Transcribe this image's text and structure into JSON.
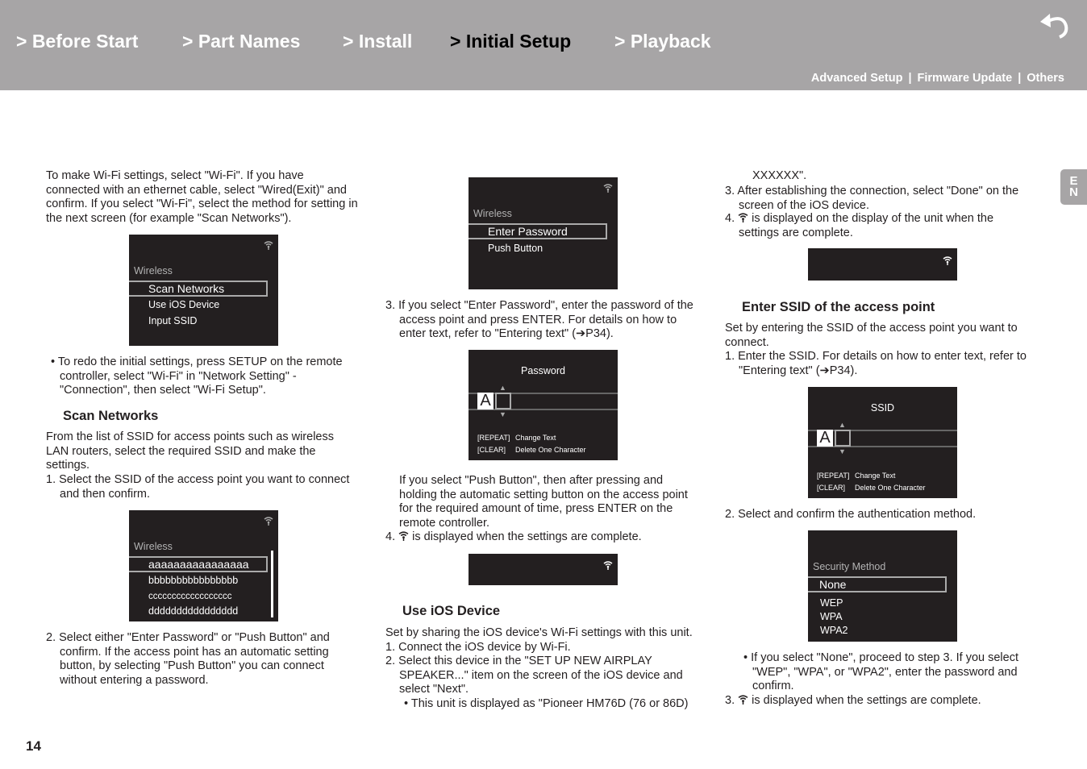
{
  "header": {
    "nav": [
      {
        "label": "> Before Start"
      },
      {
        "label": "> Part Names"
      },
      {
        "label": "> Install"
      },
      {
        "label": "> Initial Setup",
        "current": true
      },
      {
        "label": "> Playback"
      }
    ],
    "sub": [
      "Advanced Setup",
      "Firmware Update",
      "Others"
    ],
    "back_icon": "return-arrow-icon",
    "lang_tab": "EN"
  },
  "col1": {
    "p1": "To make Wi-Fi settings, select \"Wi-Fi\". If you have connected with an ethernet cable, select \"Wired(Exit)\" and confirm. If you select \"Wi-Fi\", select the method for setting in the next screen (for example \"Scan Networks\").",
    "screen1": {
      "title": "Wireless",
      "selected": "Scan Networks",
      "items": [
        "Use iOS Device",
        "Input SSID"
      ]
    },
    "b1": "• To redo the initial settings, press SETUP on the remote controller, select \"Wi-Fi\" in \"Network Setting\" - \"Connection\", then select \"Wi-Fi Setup\".",
    "h1": "Scan Networks",
    "p2": "From the list of SSID for access points such as wireless LAN routers, select the required SSID and make the settings.",
    "s1": "1. Select the SSID of the access point you want to connect and then confirm.",
    "screen2": {
      "title": "Wireless",
      "selected": "aaaaaaaaaaaaaaaa",
      "items": [
        "bbbbbbbbbbbbbbbb",
        "cccccccccccccccccc",
        "dddddddddddddddd"
      ]
    },
    "s2": "2. Select either \"Enter Password\" or \"Push Button\" and confirm. If the access point has an automatic setting button, by selecting \"Push Button\" you can connect without entering a password."
  },
  "col2": {
    "screen1": {
      "title": "Wireless",
      "selected": "Enter Password",
      "items": [
        "Push Button"
      ]
    },
    "s3": "3. If you select \"Enter Password\", enter the password of the access point and press ENTER. For details on how to enter text, refer to \"Entering text\" (➔P34).",
    "pwd": {
      "title": "Password",
      "char": "A",
      "hints": [
        [
          "[REPEAT]",
          "Change Text"
        ],
        [
          "[CLEAR]",
          "Delete One Character"
        ]
      ]
    },
    "p1": "If you select \"Push Button\", then after pressing and holding the automatic setting button on the access point for the required amount of time, press ENTER on the remote controller.",
    "s4_num": "4.",
    "s4": "is displayed when the settings are complete.",
    "h1": "Use iOS Device",
    "p2": "Set by sharing the iOS device's Wi-Fi settings with this unit.",
    "s1": "1. Connect the iOS device by Wi-Fi.",
    "s2": "2. Select this device in the \"SET UP NEW AIRPLAY SPEAKER...\" item on the screen of the iOS device and select \"Next\".",
    "b1": "• This unit is displayed as \"Pioneer HM76D (76 or 86D)"
  },
  "col3": {
    "cont": "XXXXXX\".",
    "s3": "3. After establishing the connection, select \"Done\" on the screen of the iOS device.",
    "s4_num": "4.",
    "s4": "is displayed on the display of the unit when the settings are complete.",
    "h1": "Enter SSID of the access point",
    "p1": "Set by entering the SSID of the access point you want to connect.",
    "s1": "1. Enter the SSID. For details on how to enter text, refer to \"Entering text\" (➔P34).",
    "ssid": {
      "title": "SSID",
      "char": "A",
      "hints": [
        [
          "[REPEAT]",
          "Change Text"
        ],
        [
          "[CLEAR]",
          "Delete One Character"
        ]
      ]
    },
    "s2": "2. Select and confirm the authentication method.",
    "sec": {
      "title": "Security Method",
      "selected": "None",
      "items": [
        "WEP",
        "WPA",
        "WPA2"
      ]
    },
    "b1": "• If you select \"None\", proceed to step 3. If you select \"WEP\", \"WPA\", or \"WPA2\", enter the password and confirm.",
    "s3b_num": "3.",
    "s3b": "is displayed when the settings are complete."
  },
  "page_number": "14"
}
